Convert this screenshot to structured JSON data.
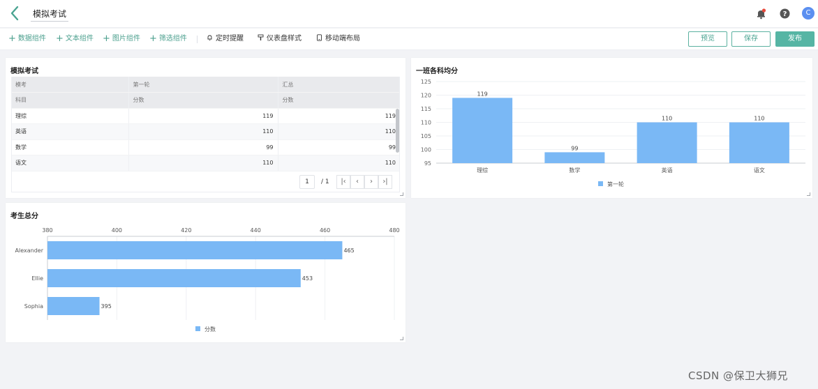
{
  "header": {
    "title": "模拟考试",
    "avatar_letter": "C",
    "icons": [
      "back-arrow-icon",
      "bell-icon",
      "help-icon"
    ]
  },
  "toolbar": {
    "add_items": [
      {
        "icon": "plus-icon",
        "label": "数据组件"
      },
      {
        "icon": "plus-icon",
        "label": "文本组件"
      },
      {
        "icon": "plus-icon",
        "label": "图片组件"
      },
      {
        "icon": "plus-icon",
        "label": "筛选组件"
      }
    ],
    "tools": [
      {
        "icon": "bell-icon",
        "label": "定时提醒"
      },
      {
        "icon": "paint-brush-icon",
        "label": "仪表盘样式"
      },
      {
        "icon": "mobile-icon",
        "label": "移动端布局"
      }
    ],
    "preview_label": "预览",
    "save_label": "保存",
    "publish_label": "发布"
  },
  "table_panel": {
    "title": "模拟考试",
    "header_row1": [
      "模考",
      "第一轮",
      "汇总"
    ],
    "header_row2": [
      "科目",
      "分数",
      "分数"
    ],
    "rows": [
      {
        "subject": "理综",
        "score": "119",
        "total": "119"
      },
      {
        "subject": "英语",
        "score": "110",
        "total": "110"
      },
      {
        "subject": "数学",
        "score": "99",
        "total": "99"
      },
      {
        "subject": "语文",
        "score": "110",
        "total": "110"
      }
    ],
    "pager": {
      "current": "1",
      "total": "/ 1"
    }
  },
  "chart_data": [
    {
      "type": "bar",
      "title": "一班各科均分",
      "categories": [
        "理综",
        "数学",
        "英语",
        "语文"
      ],
      "series": [
        {
          "name": "第一轮",
          "values": [
            119,
            99,
            110,
            110
          ]
        }
      ],
      "ylim": [
        95,
        125
      ],
      "yticks": [
        95,
        100,
        105,
        110,
        115,
        120,
        125
      ],
      "legend": "bottom",
      "color": "#7ab8f5",
      "grid": true
    },
    {
      "type": "bar",
      "orientation": "horizontal",
      "title": "考生总分",
      "categories": [
        "Alexander",
        "Ellie",
        "Sophia"
      ],
      "series": [
        {
          "name": "分数",
          "values": [
            465,
            453,
            395
          ]
        }
      ],
      "xlim": [
        380,
        480
      ],
      "xticks": [
        380,
        400,
        420,
        440,
        460,
        480
      ],
      "legend": "bottom",
      "color": "#7ab8f5",
      "grid": true
    }
  ],
  "watermark": "CSDN @保卫大狮兄"
}
